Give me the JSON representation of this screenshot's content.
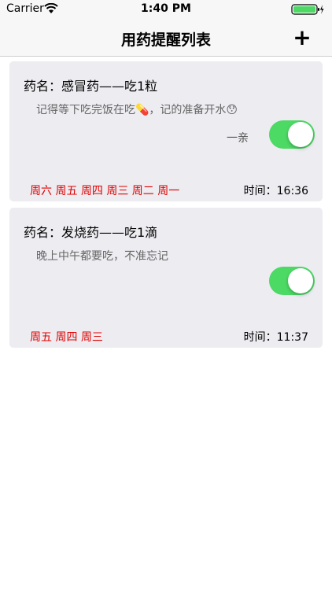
{
  "status_bar": {
    "carrier": "Carrier",
    "time": "1:40 PM"
  },
  "nav": {
    "title": "用药提醒列表",
    "add_label": "+"
  },
  "reminders": [
    {
      "title": "药名：感冒药——吃1粒",
      "note": "记得等下吃完饭在吃💊，记的准备开水😯",
      "sender": "一亲",
      "enabled": true,
      "days": "周六 周五 周四 周三 周二 周一",
      "time": "时间：16:36"
    },
    {
      "title": "药名：发烧药——吃1滴",
      "note": "晚上中午都要吃，不准忘记",
      "sender": "",
      "enabled": true,
      "days": "周五 周四 周三",
      "time": "时间：11:37"
    }
  ],
  "colors": {
    "toggle_on": "#4cd964",
    "days_text": "#e00000",
    "card_bg": "#ececf1"
  }
}
